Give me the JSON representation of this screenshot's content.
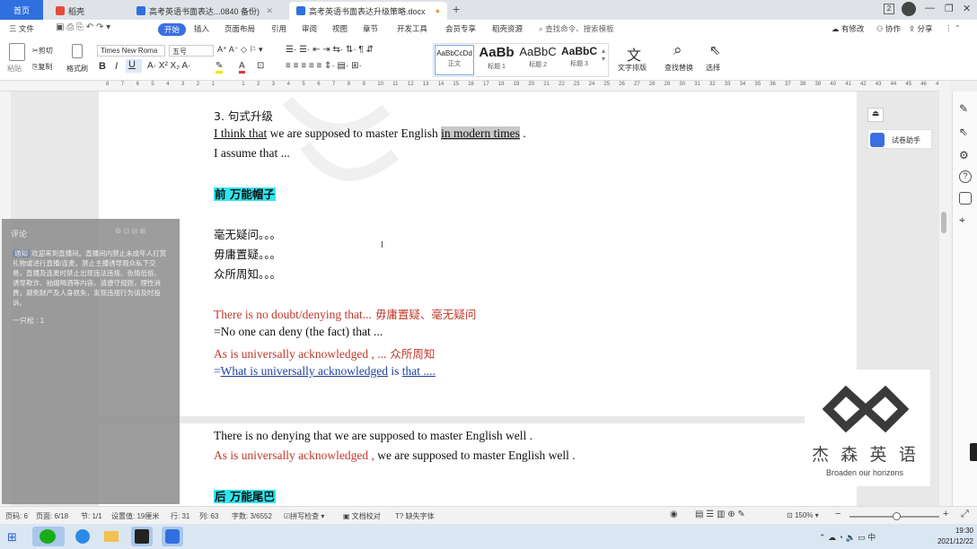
{
  "tabs": [
    {
      "label": "首页"
    },
    {
      "label": "稻壳"
    },
    {
      "label": "高考英语书面表达...0840 备份)"
    },
    {
      "label": "高考英语书面表达升级策略.docx"
    }
  ],
  "tab_add": "+",
  "window_counter": "2",
  "menu": {
    "file": "三 文件",
    "items": [
      "开始",
      "插入",
      "页面布局",
      "引用",
      "审阅",
      "视图",
      "章节",
      "开发工具",
      "会员专享",
      "稻壳资源"
    ],
    "search_placeholder": "查找命令、搜索模板",
    "right": [
      "有修改",
      "协作",
      "分享"
    ]
  },
  "ribbon": {
    "paste": "粘贴",
    "cut": "剪切",
    "copy": "复制",
    "format_painter": "格式刷",
    "font_name": "Times New Roma",
    "font_size": "五号",
    "styles": [
      {
        "sample": "AaBbCcDd",
        "name": "正文"
      },
      {
        "sample": "AaBb",
        "name": "标题 1"
      },
      {
        "sample": "AaBbC",
        "name": "标题 2"
      },
      {
        "sample": "AaBbC",
        "name": "标题 3"
      }
    ],
    "text_layout": "文字排版",
    "find_replace": "查找替换",
    "select": "选择"
  },
  "ruler_numbers": [
    "8",
    "7",
    "6",
    "5",
    "4",
    "3",
    "2",
    "1",
    "",
    "1",
    "2",
    "3",
    "4",
    "5",
    "6",
    "7",
    "8",
    "9",
    "10",
    "11",
    "12",
    "13",
    "14",
    "15",
    "16",
    "17",
    "18",
    "19",
    "20",
    "21",
    "22",
    "23",
    "24",
    "25",
    "26",
    "27",
    "28",
    "29",
    "30",
    "31",
    "32",
    "33",
    "34",
    "35",
    "36",
    "37",
    "38",
    "39",
    "40",
    "41",
    "42",
    "43",
    "44",
    "45",
    "46",
    "47"
  ],
  "document": {
    "heading": "3.  句式升级",
    "line1_a": "I think that",
    "line1_b": " we are supposed to master English ",
    "line1_c": "in modern times",
    "line1_d": " .",
    "line2": "I assume that ...",
    "section_front": "前  万能帽子",
    "cn1": "毫无疑问。。。",
    "cn2": "毋庸置疑。。。",
    "cn3": "众所周知。。。",
    "red1_en": "There is no doubt/denying that...",
    "red1_cn": "  毋庸置疑、毫无疑问",
    "line_deny": "=No one can deny (the fact) that ...",
    "red2_en": "As is universally acknowledged , ...",
    "red2_cn": "    众所周知",
    "blue_eq": "=",
    "blue_a": "What is universally acknowledged",
    "blue_b": " is ",
    "blue_c": "that ....  ",
    "p2_line1": "There is no denying that we are supposed to master English well .",
    "p2_line2_red": "As is universally acknowledged ,",
    "p2_line2_rest": " we are supposed to master English well .",
    "section_back": "后  万能尾巴"
  },
  "comment": {
    "title": "评论",
    "tag": "通知",
    "body": "欢迎来到直播间。直播间内禁止未成年人打赏礼物或进行直播/连麦。禁止主播诱导观众私下交易，直播及连麦时禁止出现违法违规、色情低俗、诱导欺诈、抽烟喝酒等内容。请遵守规则，理性消费，避免财产及人身损失，发现违规行为请及时投诉。",
    "footer": "一只松 : 1"
  },
  "right_panel": {
    "assistant": "试卷助手"
  },
  "status": {
    "page": "页码: 6",
    "pages": "页面: 6/18",
    "section": "节: 1/1",
    "setting": "设置值: 19厘米",
    "row": "行: 31",
    "col": "列: 63",
    "words": "字数: 3/6552",
    "spell": "拼写检查",
    "proof": "文档校对",
    "missing_font": "缺失字体",
    "zoom": "150%"
  },
  "logo": {
    "cn": "杰 森 英 语",
    "en": "Broaden our horizons"
  },
  "clock": {
    "time": "19:30",
    "date": "2021/12/22"
  },
  "colors": {
    "accent": "#3b6fe0",
    "red_text": "#c0392b",
    "blue_text": "#1f3fa0",
    "cyan_highlight": "#2fe6f2"
  }
}
